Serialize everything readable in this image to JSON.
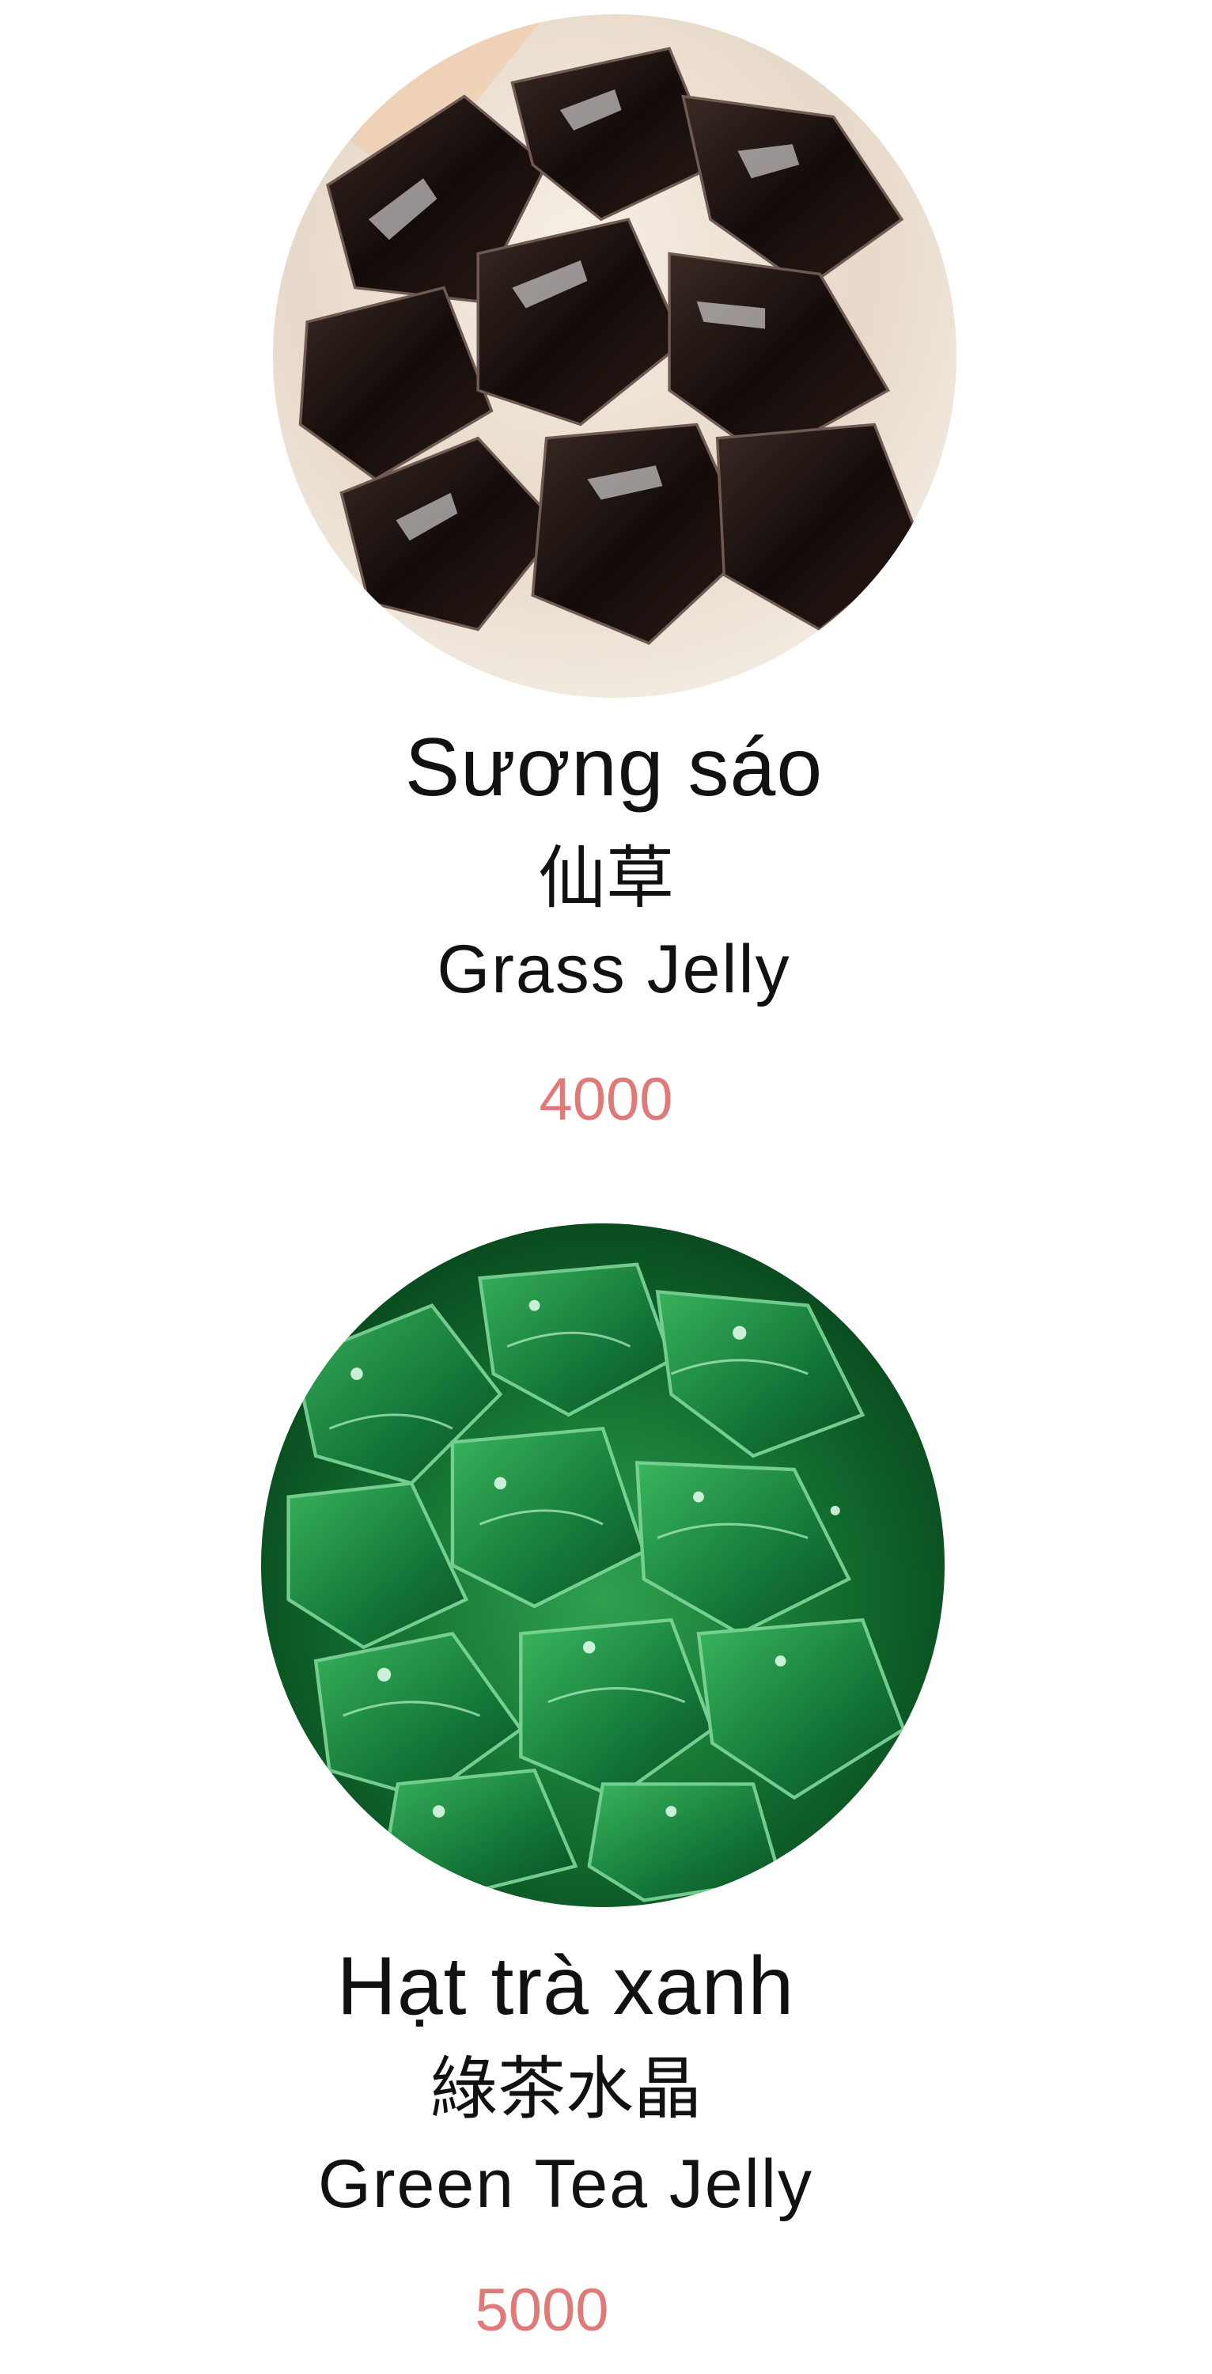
{
  "accent_color": "#e07a78",
  "items": [
    {
      "name_vi": "Sương sáo",
      "name_zh": "仙草",
      "name_en": "Grass Jelly",
      "price": "4000",
      "photo_icon": "grass-jelly-photo"
    },
    {
      "name_vi": "Hạt trà xanh",
      "name_zh": "綠茶水晶",
      "name_en": "Green Tea Jelly",
      "price": "5000",
      "photo_icon": "green-tea-jelly-photo"
    }
  ]
}
